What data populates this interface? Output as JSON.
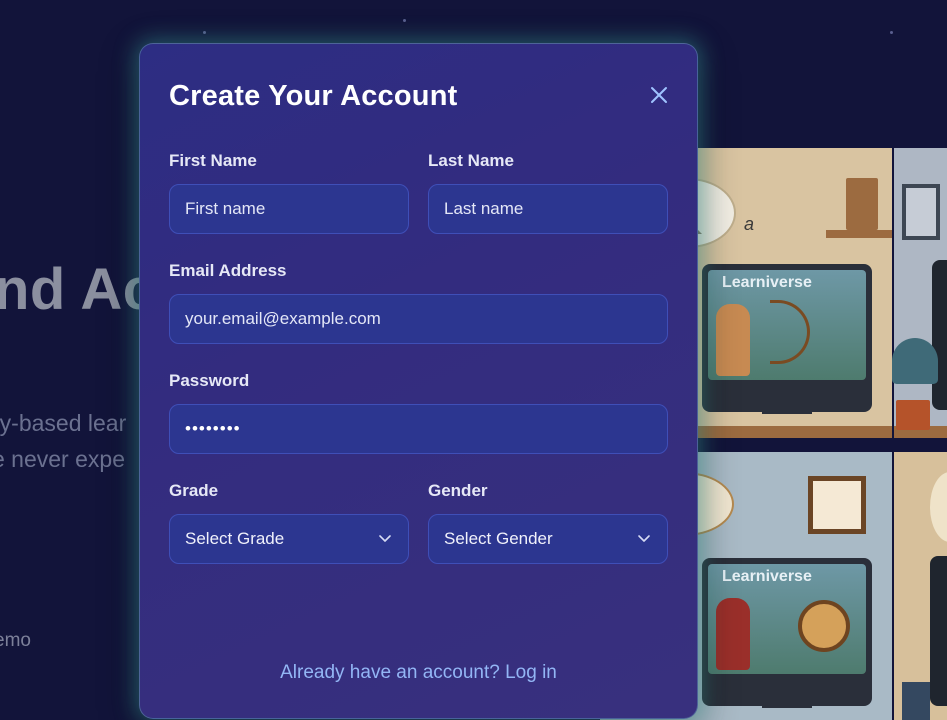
{
  "background": {
    "headline": "nd Ac",
    "subtitle_line1": "ry-based lear",
    "subtitle_line2": "e never expe",
    "demo_text": "emo",
    "illustration_label_top": "Learniverse",
    "illustration_label_bottom": "Learniverse",
    "illustration_letter": "a"
  },
  "modal": {
    "title": "Create Your Account",
    "close_icon": "close-icon",
    "first_name": {
      "label": "First Name",
      "placeholder": "First name",
      "value": ""
    },
    "last_name": {
      "label": "Last Name",
      "placeholder": "Last name",
      "value": ""
    },
    "email": {
      "label": "Email Address",
      "placeholder": "your.email@example.com",
      "value": ""
    },
    "password": {
      "label": "Password",
      "value": "••••••••"
    },
    "grade": {
      "label": "Grade",
      "selected": "Select Grade"
    },
    "gender": {
      "label": "Gender",
      "selected": "Select Gender"
    },
    "login_link": "Already have an account? Log in"
  },
  "colors": {
    "modal_bg": "#2f2e82",
    "input_bg": "#2c3690",
    "input_border": "#3f4fb8",
    "glow": "#46c8be",
    "link": "#93b6f5"
  }
}
